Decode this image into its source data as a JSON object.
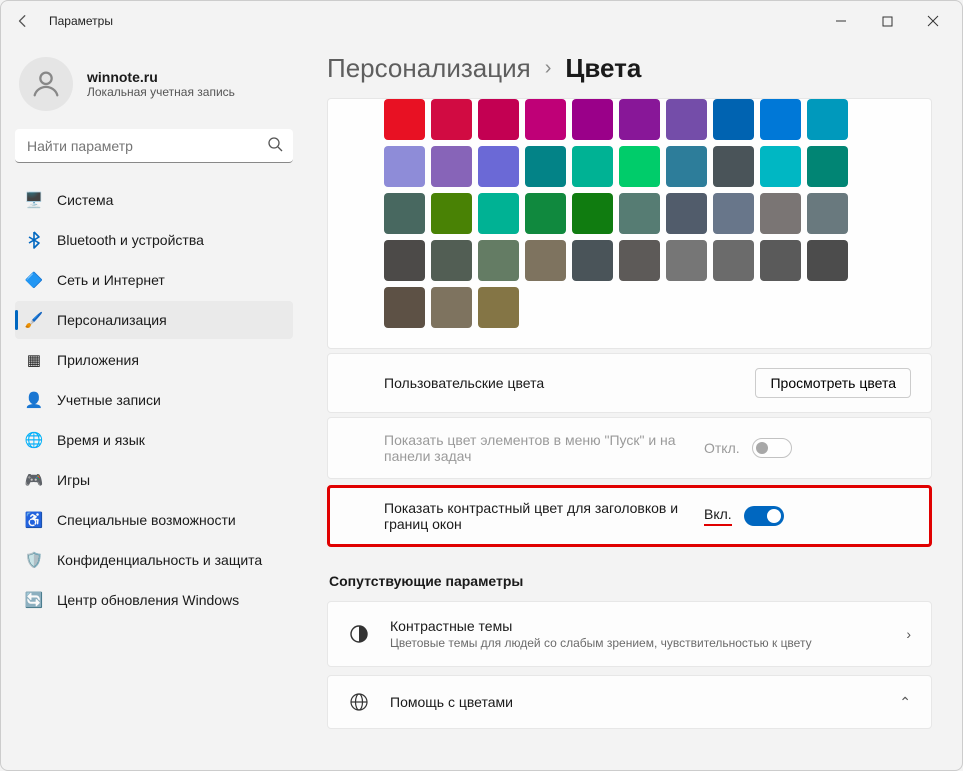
{
  "window": {
    "title": "Параметры"
  },
  "user": {
    "name": "winnote.ru",
    "sub": "Локальная учетная запись"
  },
  "search": {
    "placeholder": "Найти параметр"
  },
  "nav": [
    {
      "id": "system",
      "label": "Система",
      "icon": "🖥️"
    },
    {
      "id": "bluetooth",
      "label": "Bluetooth и устройства",
      "icon": "bt"
    },
    {
      "id": "network",
      "label": "Сеть и Интернет",
      "icon": "🔷"
    },
    {
      "id": "personalization",
      "label": "Персонализация",
      "icon": "🖌️",
      "selected": true
    },
    {
      "id": "apps",
      "label": "Приложения",
      "icon": "▦"
    },
    {
      "id": "accounts",
      "label": "Учетные записи",
      "icon": "👤"
    },
    {
      "id": "time",
      "label": "Время и язык",
      "icon": "🌐"
    },
    {
      "id": "gaming",
      "label": "Игры",
      "icon": "🎮"
    },
    {
      "id": "accessibility",
      "label": "Специальные возможности",
      "icon": "♿"
    },
    {
      "id": "privacy",
      "label": "Конфиденциальность и защита",
      "icon": "🛡️"
    },
    {
      "id": "update",
      "label": "Центр обновления Windows",
      "icon": "🔄"
    }
  ],
  "breadcrumb": {
    "parent": "Персонализация",
    "current": "Цвета"
  },
  "palette": [
    "#e81123",
    "#d10b42",
    "#c30052",
    "#bf0077",
    "#9a0089",
    "#881798",
    "#744da9",
    "#0063b1",
    "#0078d7",
    "#0099bc",
    "#8e8cd8",
    "#8764b8",
    "#6b69d6",
    "#038387",
    "#00b294",
    "#00cc6a",
    "#2d7d9a",
    "#4a5459",
    "#00b7c3",
    "#018574",
    "#486860",
    "#498205",
    "#00b294",
    "#10893e",
    "#107c10",
    "#567c73",
    "#515c6b",
    "#68768a",
    "#7a7574",
    "#69797e",
    "#4c4a48",
    "#525e54",
    "#647c64",
    "#7e735f",
    "#4a5459",
    "#5d5a58",
    "#767676",
    "#6b6b6b",
    "#5a5a5a",
    "#4c4c4c",
    "#5d5145",
    "#7e735f",
    "#847545"
  ],
  "customColorsRow": {
    "label": "Пользовательские цвета",
    "button": "Просмотреть цвета"
  },
  "startPanelRow": {
    "label": "Показать цвет элементов в меню \"Пуск\" и на панели задач",
    "state": "Откл."
  },
  "titlebarRow": {
    "label": "Показать контрастный цвет для заголовков и границ окон",
    "state": "Вкл."
  },
  "relatedHeading": "Сопутствующие параметры",
  "contrastCard": {
    "title": "Контрастные темы",
    "sub": "Цветовые темы для людей со слабым зрением, чувствительностью к цвету"
  },
  "helpCard": {
    "title": "Помощь с цветами"
  }
}
